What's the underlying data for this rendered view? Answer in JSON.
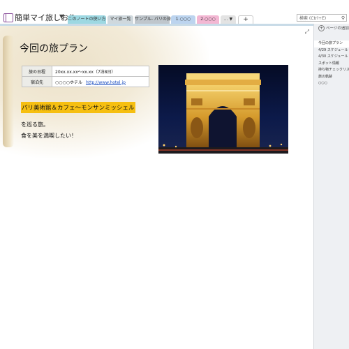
{
  "notebook": {
    "title": "簡単マイ旅しおり",
    "caret": "▼"
  },
  "tabs": [
    {
      "label": "このノートの使い方"
    },
    {
      "label": "マイ旅一覧"
    },
    {
      "label": "サンプル- パリの旅"
    },
    {
      "label": "1.○○○"
    },
    {
      "label": "2.○○○"
    },
    {
      "label": "... ▼"
    },
    {
      "label": "+"
    }
  ],
  "search": {
    "placeholder": "検索 (Ctrl+E)"
  },
  "page": {
    "title": "今回の旅プラン",
    "table": {
      "rows": [
        {
          "label": "旅の日程",
          "value": "20xx.xx.xx〜xx.xx（7泊8日）"
        },
        {
          "label": "宿泊先",
          "value": "○○○○ホテル",
          "link": "http://www.hotel.jp"
        }
      ]
    },
    "highlight_text": "パリ美術館＆カフェ〜モンサンミッシェル",
    "line1": "を巡る旅。",
    "line2": "食を美を満喫したい！"
  },
  "sidebar": {
    "add_page": "ページの追加",
    "pages": [
      {
        "label": "今回の旅プラン"
      },
      {
        "label": "4/29 スケジュール"
      },
      {
        "label": "4/30 スケジュール"
      },
      {
        "label": "スポット情報"
      },
      {
        "label": "持ち物チェックリスト"
      },
      {
        "label": "旅の軌跡"
      },
      {
        "label": "○○○"
      }
    ]
  },
  "colors": {
    "highlight": "#f6bf11",
    "link": "#1d4fc1"
  },
  "icons": {
    "notebook": "notebook-icon",
    "search": "search-icon",
    "expand": "expand-icon",
    "add_page": "plus-circle-icon"
  }
}
